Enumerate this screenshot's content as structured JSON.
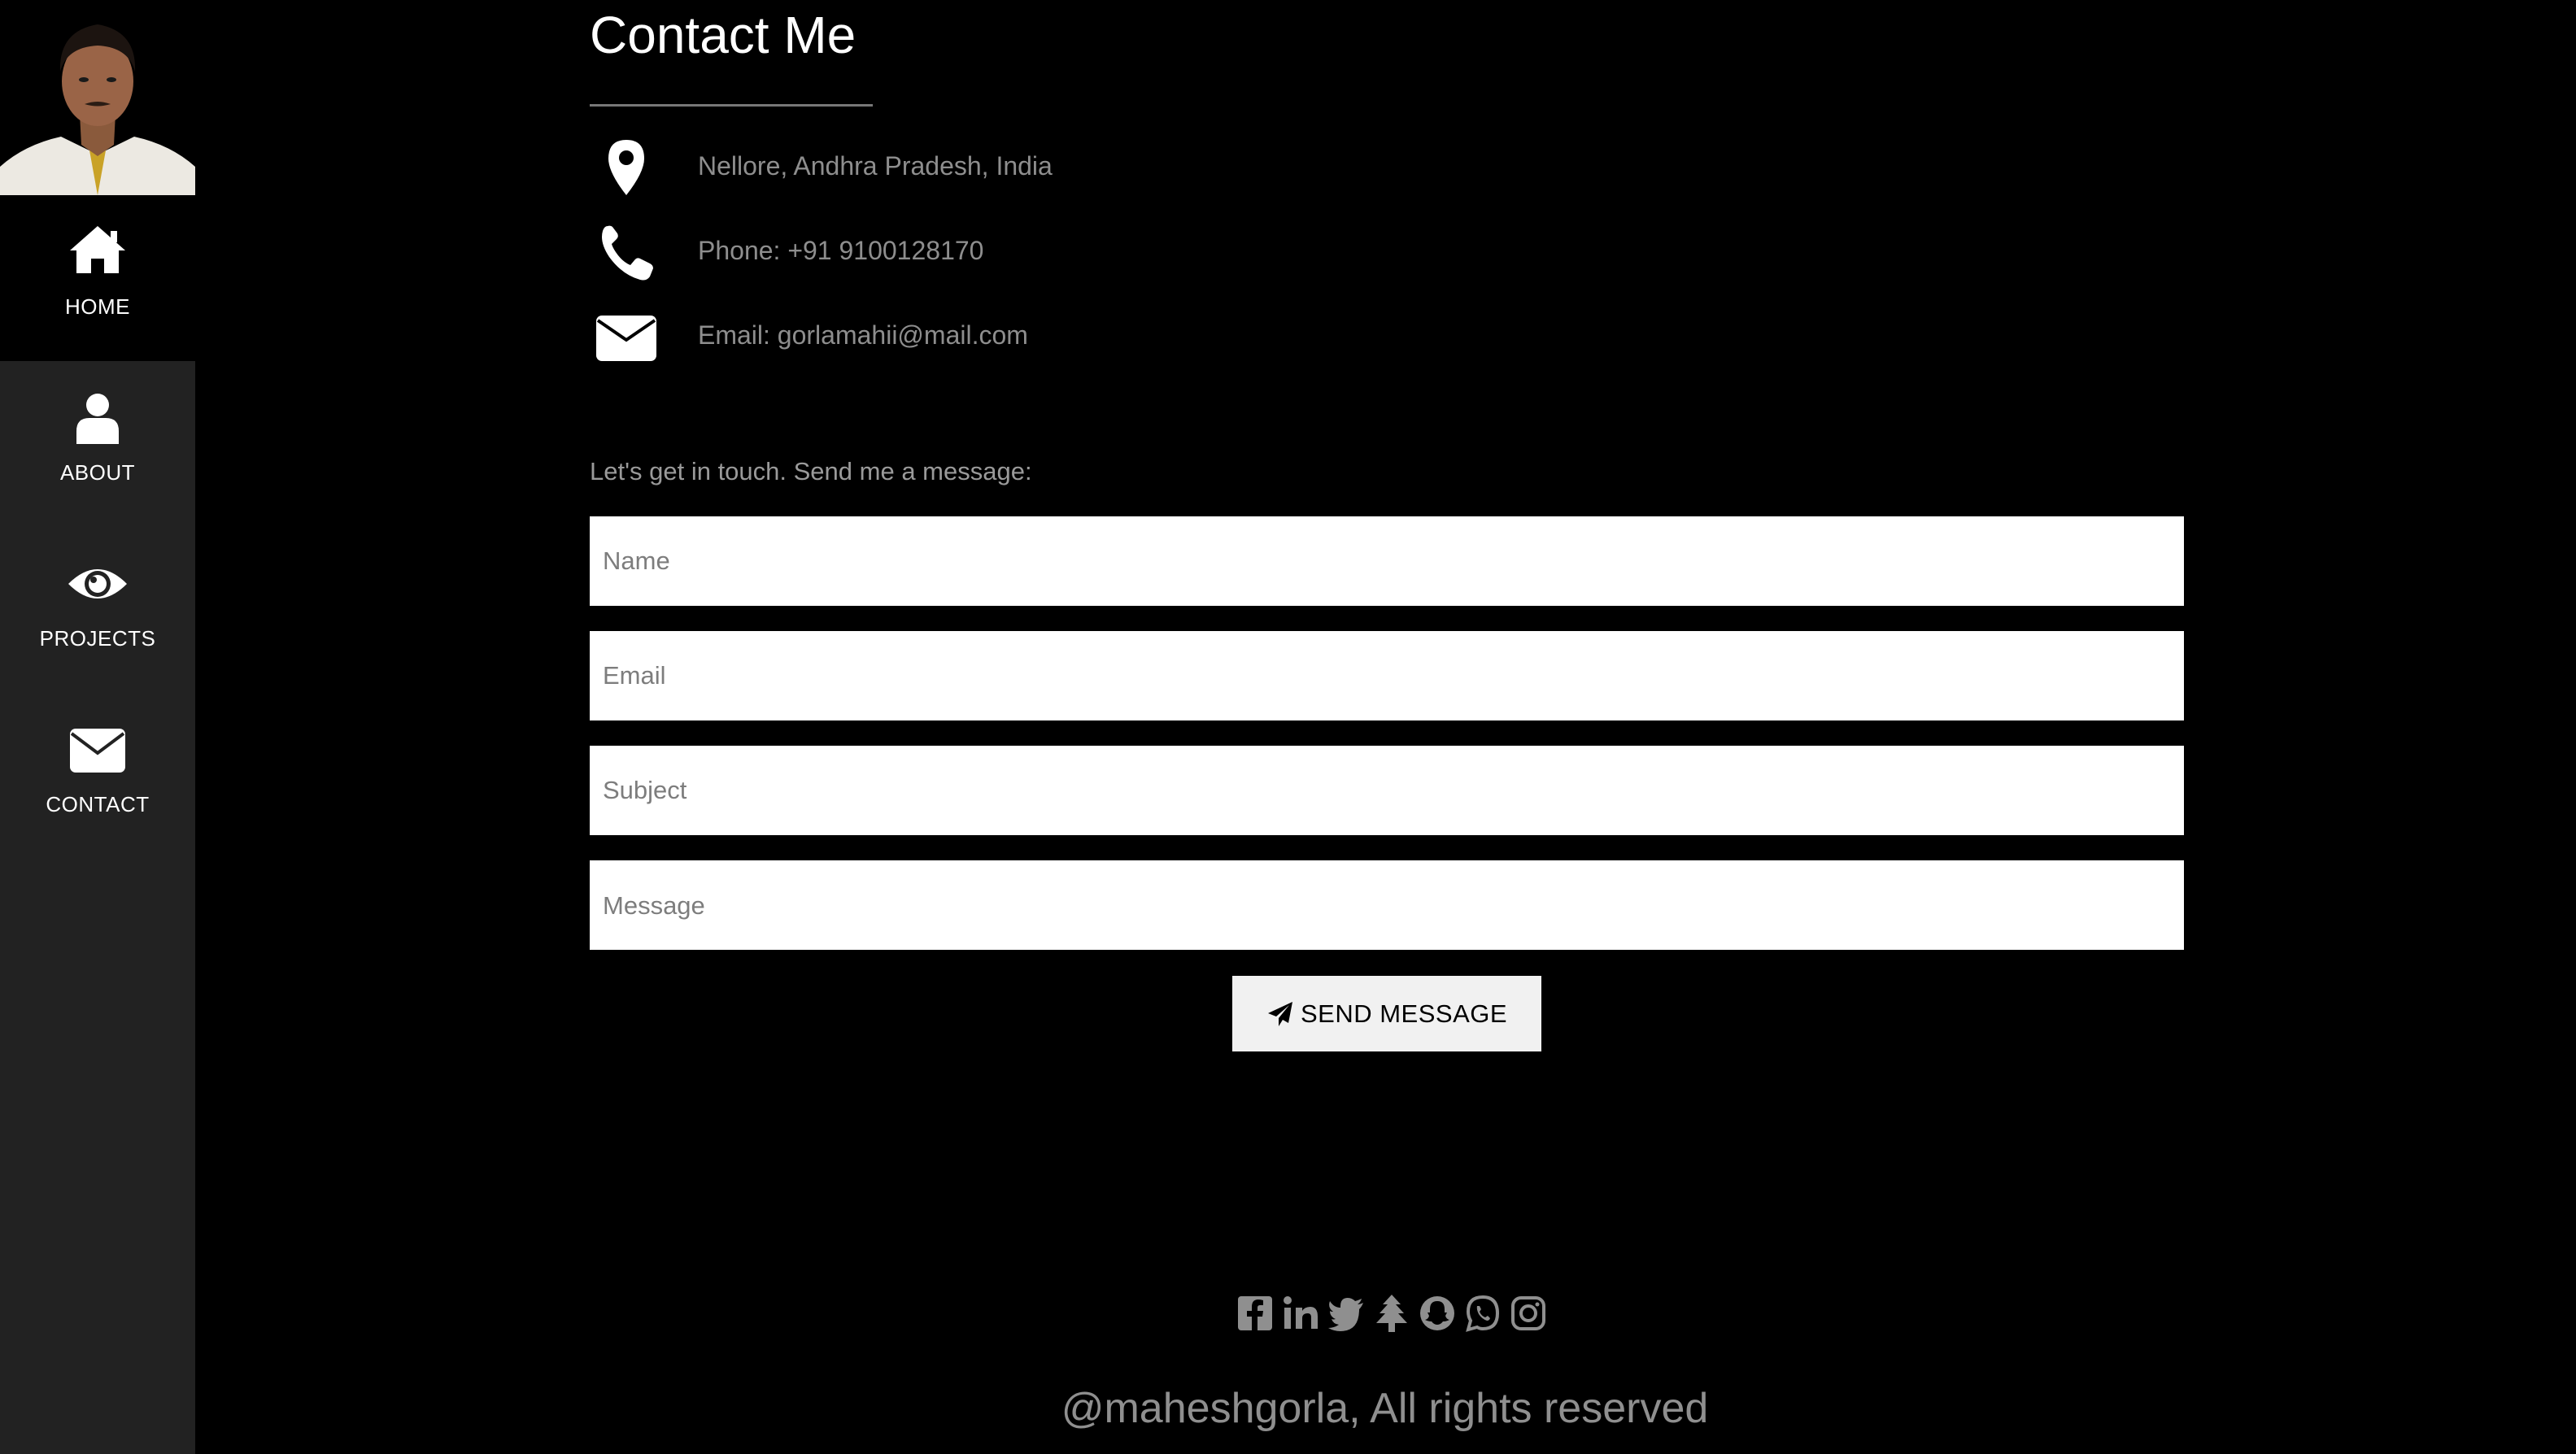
{
  "sidebar": {
    "avatar_alt": "Profile photo",
    "nav": [
      {
        "label": "HOME",
        "icon": "home-icon",
        "active": true
      },
      {
        "label": "ABOUT",
        "icon": "user-icon",
        "active": false
      },
      {
        "label": "PROJECTS",
        "icon": "eye-icon",
        "active": false
      },
      {
        "label": "CONTACT",
        "icon": "envelope-icon",
        "active": false
      }
    ]
  },
  "main": {
    "title": "Contact Me",
    "info": [
      {
        "icon": "map-marker-icon",
        "text": "Nellore, Andhra Pradesh, India"
      },
      {
        "icon": "phone-icon",
        "text": "Phone: +91 9100128170"
      },
      {
        "icon": "envelope-icon",
        "text": "Email: gorlamahii@mail.com"
      }
    ],
    "intro": "Let's get in touch. Send me a message:",
    "form": {
      "name_placeholder": "Name",
      "email_placeholder": "Email",
      "subject_placeholder": "Subject",
      "message_placeholder": "Message",
      "name_value": "",
      "email_value": "",
      "subject_value": "",
      "message_value": "",
      "send_label": "SEND MESSAGE"
    }
  },
  "footer": {
    "social": [
      "facebook-icon",
      "linkedin-icon",
      "twitter-icon",
      "linktree-icon",
      "snapchat-icon",
      "whatsapp-icon",
      "instagram-icon"
    ],
    "copyright": "@maheshgorla, All rights reserved"
  },
  "colors": {
    "background": "#000000",
    "sidebar": "#222222",
    "muted_text": "#8e8e8e",
    "button_bg": "#f1f1f1"
  }
}
